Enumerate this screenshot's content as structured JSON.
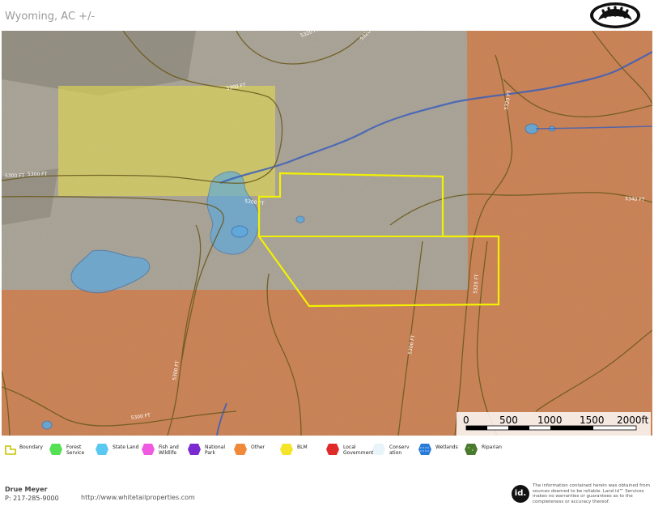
{
  "header": {
    "title": "Wyoming,  AC +/-",
    "logo_icon": "bear-paw-logo-icon"
  },
  "map": {
    "contour_labels": [
      "5300 FT",
      "5320 FT",
      "5340 FT"
    ],
    "colors": {
      "terrain": "#8a8070",
      "blm": "#e6d832",
      "other": "#e0763a",
      "state_land": "#5aa9e0",
      "boundary": "#f2f200",
      "contour": "#6b5a1e",
      "stream": "#3d5fb8"
    },
    "scale_bar": {
      "labels": [
        "0",
        "500",
        "1000",
        "1500",
        "2000ft"
      ]
    }
  },
  "legend": {
    "items": [
      {
        "label": "Boundary",
        "color": "#f2f200",
        "icon": "boundary-icon"
      },
      {
        "label": "Forest Service",
        "color": "#55e055",
        "icon": "forest-service-icon"
      },
      {
        "label": "State Land",
        "color": "#5ac8f0",
        "icon": "state-land-icon"
      },
      {
        "label": "Fish and Wildlife",
        "color": "#f05ae0",
        "icon": "fish-wildlife-icon"
      },
      {
        "label": "National Park",
        "color": "#7a2ad0",
        "icon": "national-park-icon"
      },
      {
        "label": "Other",
        "color": "#f08a3a",
        "icon": "other-icon"
      },
      {
        "label": "BLM",
        "color": "#f5e52a",
        "icon": "blm-icon"
      },
      {
        "label": "Local Government",
        "color": "#e02a2a",
        "icon": "local-government-icon"
      },
      {
        "label": "Conservation",
        "color": "#e8f4fa",
        "icon": "conservation-icon"
      },
      {
        "label": "Wetlands",
        "color": "#2a7ad8",
        "icon": "wetlands-icon"
      },
      {
        "label": "Riparian",
        "color": "#4a7a30",
        "icon": "riparian-icon"
      }
    ]
  },
  "footer": {
    "agent_name": "Drue Meyer",
    "phone": "P: 217-285-9000",
    "url": "http://www.whitetailproperties.com",
    "id_logo_text": "id.",
    "disclaimer": "The information contained herein was obtained from sources deemed to be reliable. Land id™ Services makes no warranties or guarantees as to the completeness or accuracy thereof."
  }
}
